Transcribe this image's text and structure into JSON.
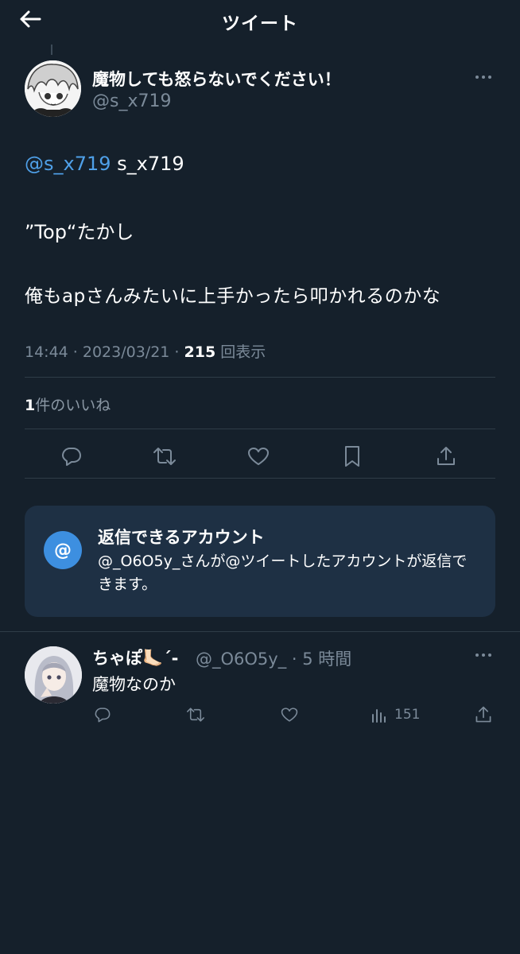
{
  "header": {
    "title": "ツイート",
    "back_icon": "arrow-left-icon"
  },
  "tweet": {
    "author_name": "魔物しても怒らないでください！",
    "author_handle": "@s_x719",
    "mention": "@s_x719",
    "line1_rest": " s_x719",
    "line2": "”Top“たかし",
    "line3": "俺もapさんみたいに上手かったら叩かれるのかな",
    "time_date": "14:44 · 2023/03/21 · ",
    "views": "215",
    "views_label": " 回表示",
    "likes_count": "1",
    "likes_label": "件のいいね",
    "actions": [
      "reply-icon",
      "retweet-icon",
      "like-icon",
      "bookmark-icon",
      "share-icon"
    ]
  },
  "reply_notice": {
    "icon_symbol": "@",
    "title": "返信できるアカウント",
    "body": "@_O6O5y_さんが@ツイートしたアカウントが返信できます。"
  },
  "reply": {
    "author_name": "ちゃぽ🦶🏻´-",
    "meta": "@_O6O5y_ · 5 時間",
    "text": "魔物なのか",
    "views": "151",
    "actions": [
      "reply-icon",
      "retweet-icon",
      "like-icon",
      "views-icon",
      "share-icon"
    ]
  },
  "colors": {
    "background": "#15202b",
    "accent": "#1d9bf0",
    "link": "#4fa0e8",
    "muted": "#7b8a99",
    "card": "#1e3044"
  }
}
